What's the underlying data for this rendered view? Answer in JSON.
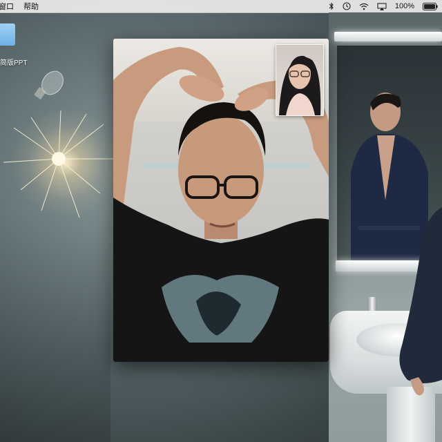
{
  "menubar": {
    "items": [
      "窗口",
      "帮助"
    ],
    "battery_text": "100%",
    "icons": [
      "bluetooth-icon",
      "clock-icon",
      "wifi-icon",
      "airplay-icon",
      "battery-icon"
    ]
  },
  "desktop": {
    "items": [
      {
        "label": "简版PPT",
        "icon": "folder-icon",
        "color": "#7cbcea"
      }
    ]
  },
  "facetime": {
    "main_video": "remote-participant-video",
    "self_view": "self-view-video"
  },
  "colors": {
    "menubar_bg": "#ececec",
    "folder_blue": "#7cbcea"
  }
}
